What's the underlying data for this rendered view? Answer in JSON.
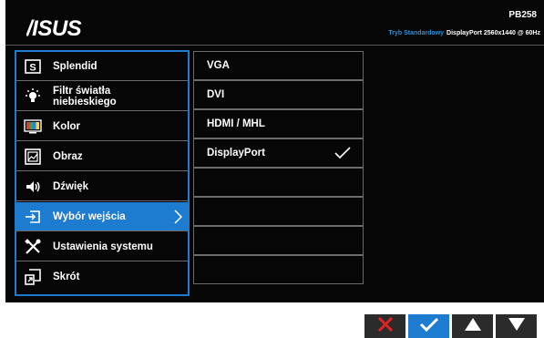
{
  "brand": "/ISUS",
  "model": "PB258",
  "status": {
    "mode": "Tryb Standardowy",
    "signal": "DisplayPort 2560x1440 @ 60Hz"
  },
  "menu": [
    {
      "label": "Splendid",
      "icon": "splendid-icon"
    },
    {
      "label": "Filtr światła\nniebieskiego",
      "icon": "bluelight-bulb-icon"
    },
    {
      "label": "Kolor",
      "icon": "color-icon"
    },
    {
      "label": "Obraz",
      "icon": "image-icon"
    },
    {
      "label": "Dźwięk",
      "icon": "speaker-icon"
    },
    {
      "label": "Wybór wejścia",
      "icon": "input-select-icon",
      "selected": true
    },
    {
      "label": "Ustawienia systemu",
      "icon": "tools-icon"
    },
    {
      "label": "Skrót",
      "icon": "shortcut-icon"
    }
  ],
  "submenu": [
    {
      "label": "VGA"
    },
    {
      "label": "DVI"
    },
    {
      "label": "HDMI / MHL"
    },
    {
      "label": "DisplayPort",
      "checked": true
    },
    {
      "label": ""
    },
    {
      "label": ""
    },
    {
      "label": ""
    },
    {
      "label": ""
    }
  ],
  "keys": [
    {
      "icon": "close-icon"
    },
    {
      "icon": "check-icon"
    },
    {
      "icon": "up-arrow-icon"
    },
    {
      "icon": "down-arrow-icon"
    }
  ],
  "colors": {
    "accent": "#1d7bd0",
    "mode_text": "#2e8fd4",
    "close_red": "#e02424",
    "background": "#060606"
  }
}
